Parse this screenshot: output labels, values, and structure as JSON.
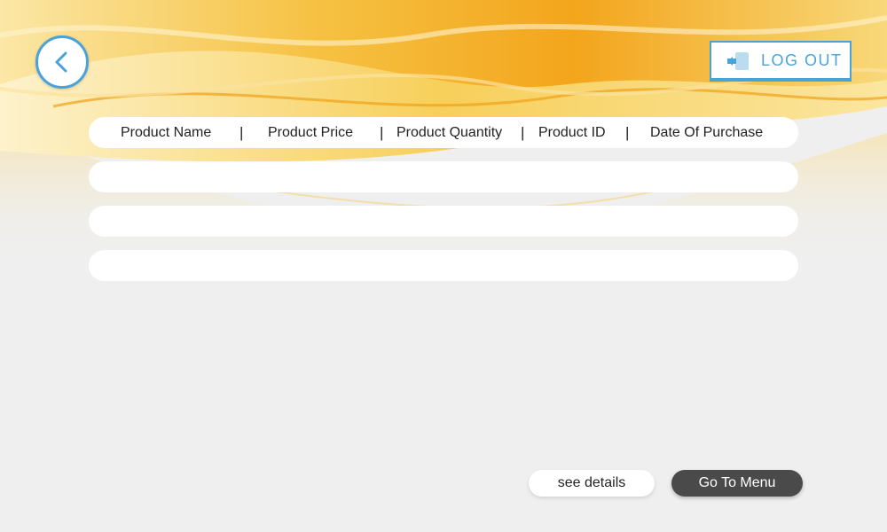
{
  "colors": {
    "accent": "#4aa3d8",
    "background": "#efefef",
    "wave_orange": "#f2a51a",
    "wave_yellow": "#f7d267",
    "menu_button_bg": "#4a4a4a"
  },
  "nav": {
    "back_icon": "chevron-left-icon",
    "logout_icon": "door-exit-icon",
    "logout_label": "LOG OUT"
  },
  "table": {
    "columns": [
      "Product Name",
      "Product Price",
      "Product Quantity",
      "Product ID",
      "Date Of Purchase"
    ],
    "separator": "|",
    "rows": [
      [
        "",
        "",
        "",
        "",
        ""
      ],
      [
        "",
        "",
        "",
        "",
        ""
      ],
      [
        "",
        "",
        "",
        "",
        ""
      ]
    ]
  },
  "actions": {
    "details_label": "see details",
    "menu_label": "Go To Menu"
  }
}
